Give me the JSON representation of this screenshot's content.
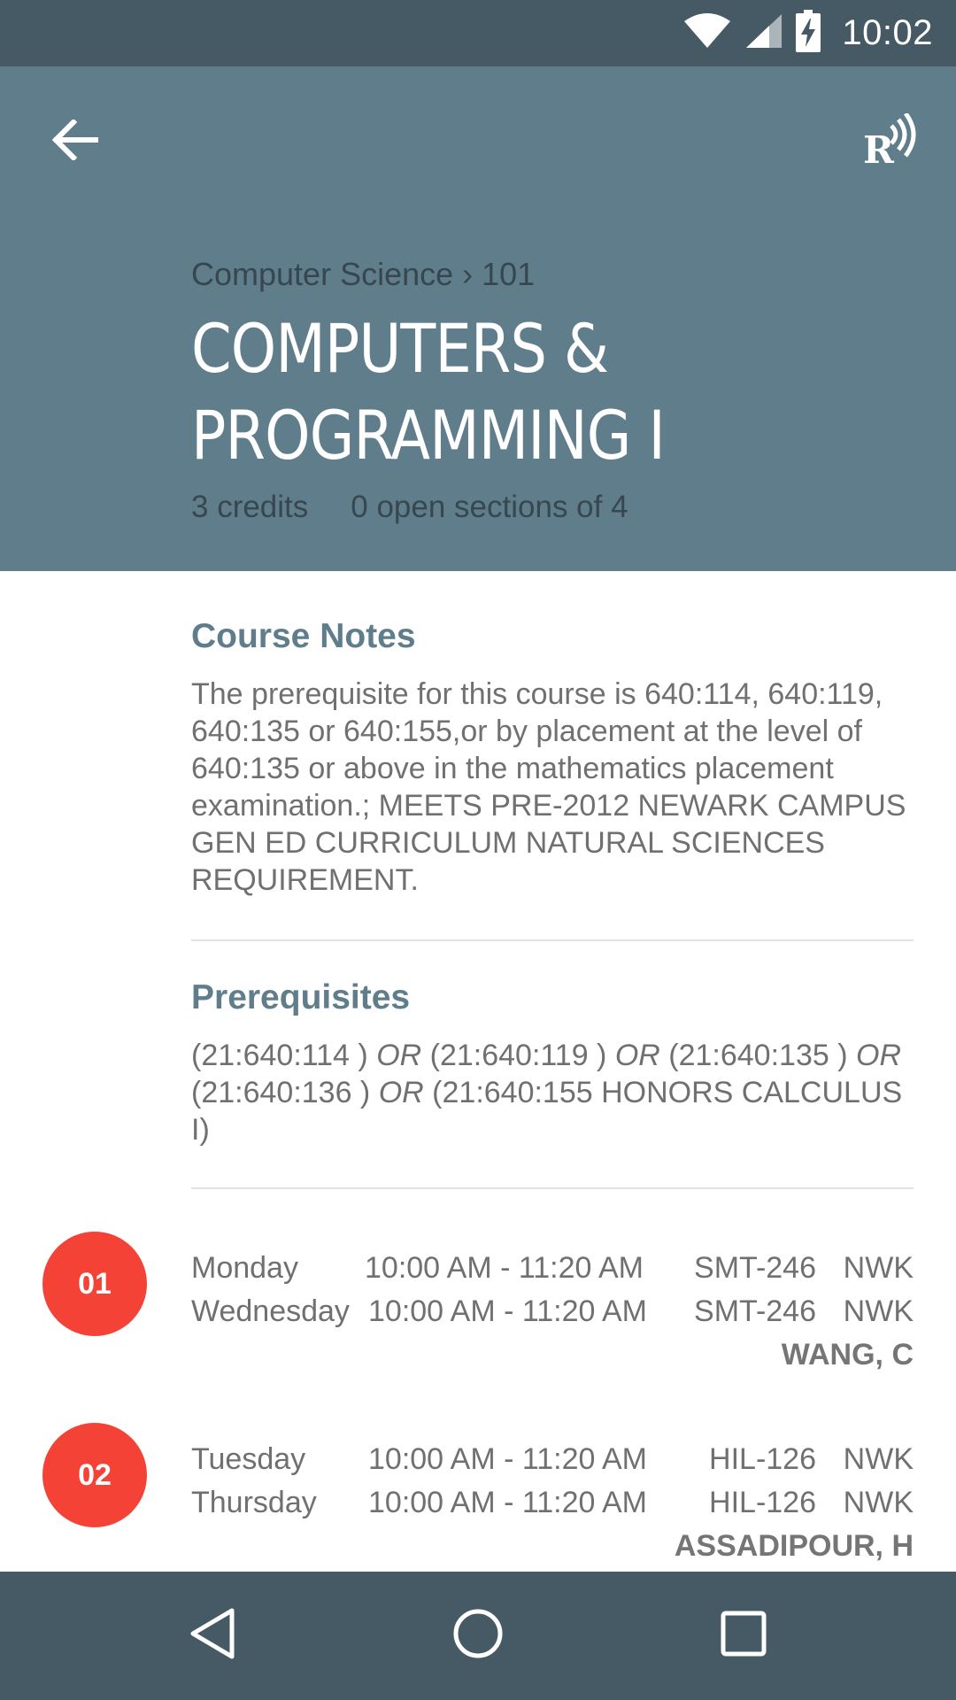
{
  "status_bar": {
    "time": "10:02",
    "icons": [
      "wifi-icon",
      "cellular-signal-icon",
      "battery-charging-icon"
    ]
  },
  "toolbar": {
    "back_icon": "arrow-left-icon",
    "action_icon": "rutgers-radio-icon"
  },
  "course": {
    "breadcrumb": "Computer Science › 101",
    "title": "COMPUTERS & PROGRAMMING I",
    "credits": "3 credits",
    "open_sections": "0 open sections of 4"
  },
  "course_notes": {
    "heading": "Course Notes",
    "body": "The prerequisite for this course is 640:114, 640:119, 640:135 or 640:155,or by placement at the level of 640:135 or above in the mathematics placement examination.; MEETS PRE-2012 NEWARK CAMPUS GEN ED CURRICULUM NATURAL SCIENCES REQUIREMENT."
  },
  "prerequisites": {
    "heading": "Prerequisites",
    "parts": [
      "(21:640:114 )",
      "OR",
      "(21:640:119 )",
      "OR",
      "(21:640:135 )",
      "OR",
      "(21:640:136 )",
      "OR",
      "(21:640:155 HONORS CALCULUS I)"
    ]
  },
  "sections": [
    {
      "number": "01",
      "meetings": [
        {
          "day": "Monday",
          "time": "10:00 AM - 11:20 AM",
          "room": "SMT-246",
          "campus": "NWK"
        },
        {
          "day": "Wednesday",
          "time": "10:00 AM - 11:20 AM",
          "room": "SMT-246",
          "campus": "NWK"
        }
      ],
      "instructor": "WANG, C"
    },
    {
      "number": "02",
      "meetings": [
        {
          "day": "Tuesday",
          "time": "10:00 AM - 11:20 AM",
          "room": "HIL-126",
          "campus": "NWK"
        },
        {
          "day": "Thursday",
          "time": "10:00 AM - 11:20 AM",
          "room": "HIL-126",
          "campus": "NWK"
        }
      ],
      "instructor": "ASSADIPOUR, H"
    }
  ],
  "nav_bar": {
    "icons": [
      "nav-back-icon",
      "nav-home-icon",
      "nav-recents-icon"
    ]
  },
  "colors": {
    "status_bar": "#455a64",
    "header": "#607d8b",
    "section_heading": "#5f7d8b",
    "section_badge": "#f44336",
    "nav_bar": "#455a64"
  }
}
